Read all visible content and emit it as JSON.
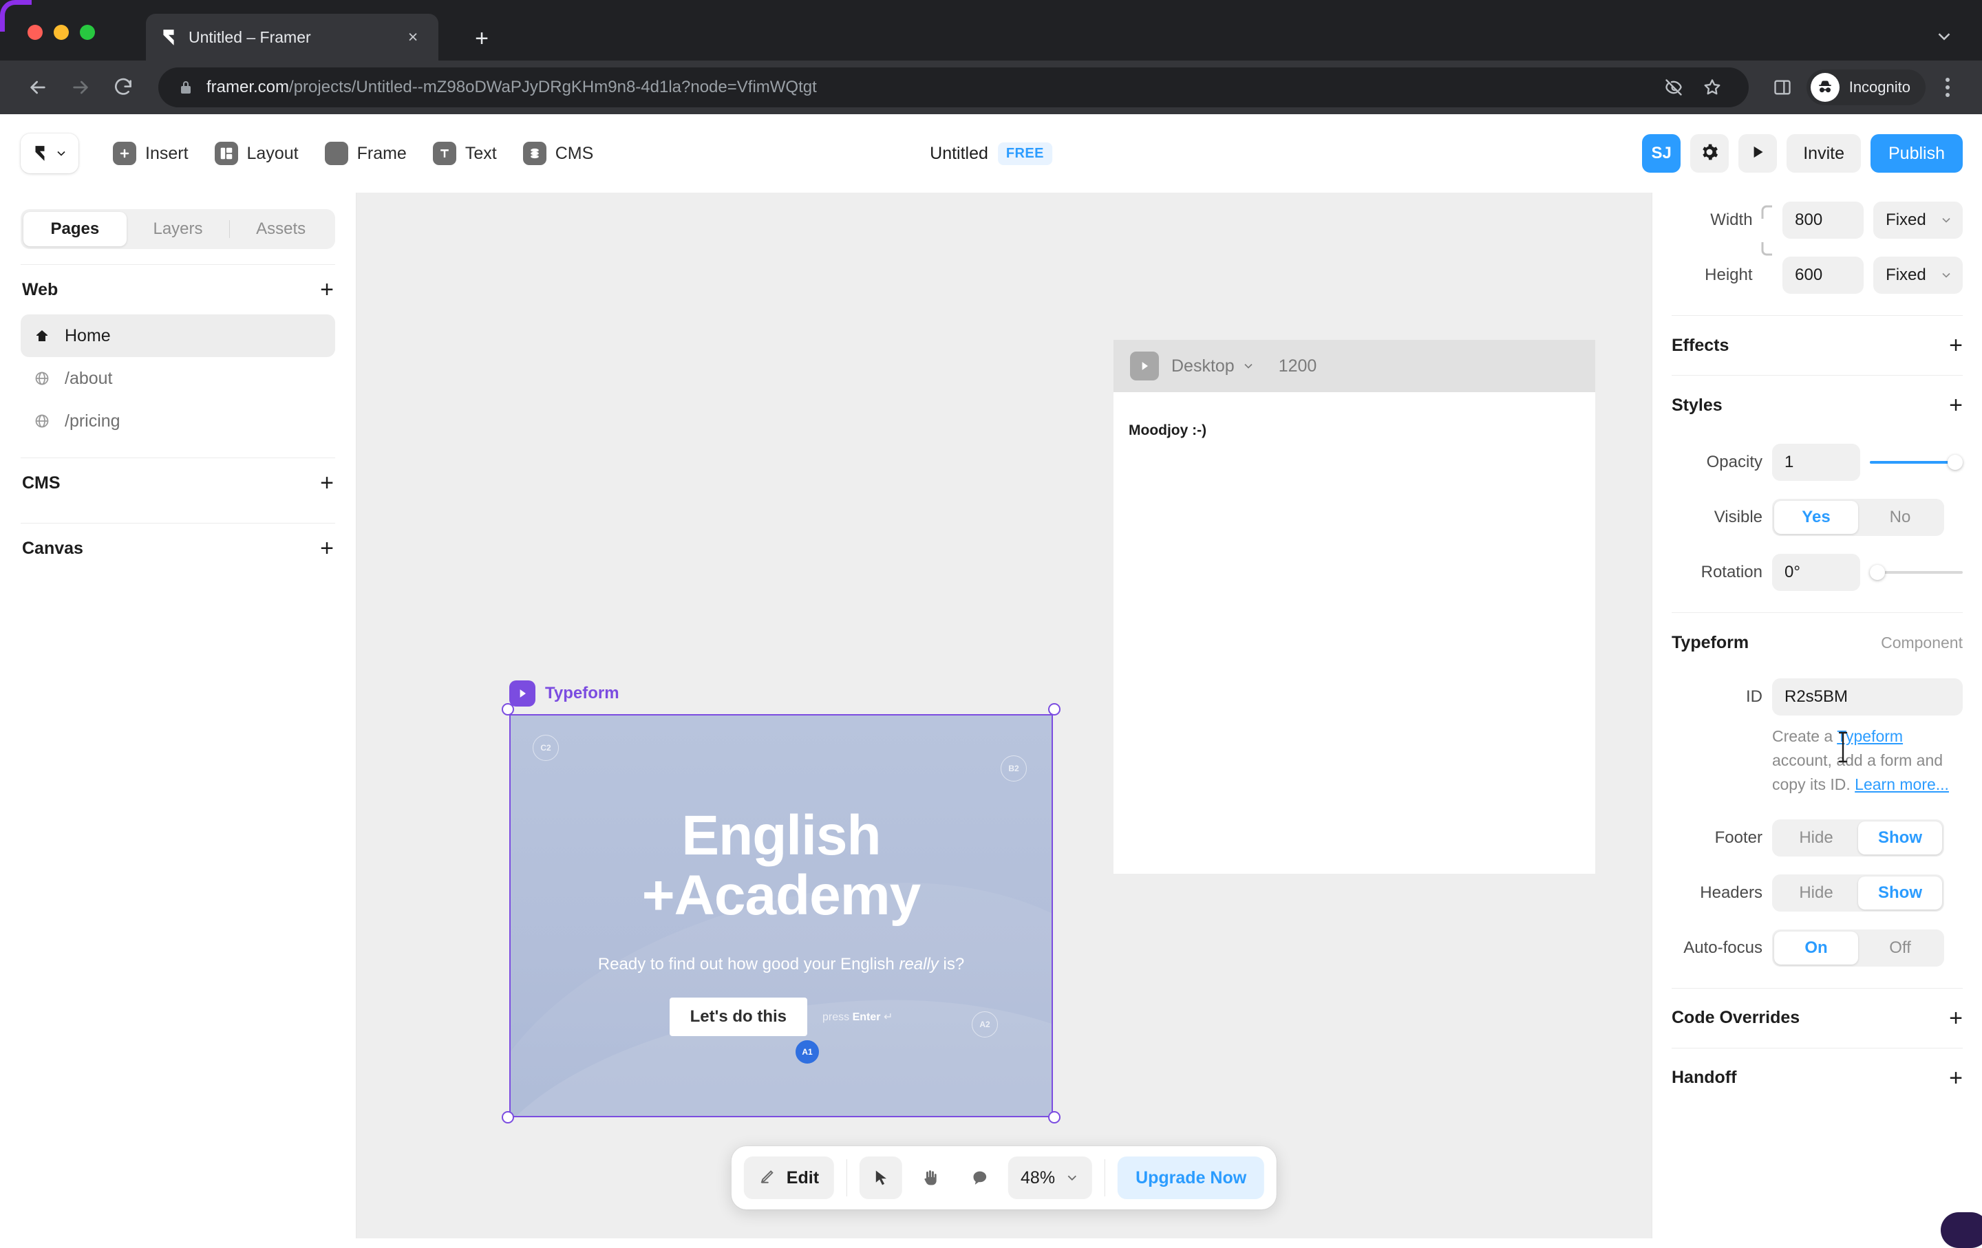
{
  "browser": {
    "tab": {
      "title": "Untitled – Framer",
      "favicon": "framer-favicon",
      "close": "×"
    },
    "new_tab": "+",
    "url": {
      "host": "framer.com",
      "path": "/projects/Untitled--mZ98oDWaPJyDRgKHm9n8-4d1la?node=VfimWQtgt"
    },
    "profile": {
      "label": "Incognito"
    },
    "icons": [
      "eye-off-icon",
      "star-icon",
      "side-panel-icon",
      "incognito-icon",
      "kebab-menu-icon"
    ]
  },
  "app": {
    "toolbar": {
      "logo": "framer-logo",
      "items": [
        {
          "label": "Insert",
          "icon": "plus-square-icon"
        },
        {
          "label": "Layout",
          "icon": "layout-icon"
        },
        {
          "label": "Frame",
          "icon": "frame-icon"
        },
        {
          "label": "Text",
          "icon": "text-t-icon"
        },
        {
          "label": "CMS",
          "icon": "cms-database-icon"
        }
      ],
      "doc_title": "Untitled",
      "plan_badge": "FREE",
      "avatar_initials": "SJ",
      "settings_icon": "gear-icon",
      "preview_icon": "play-icon",
      "invite_label": "Invite",
      "publish_label": "Publish"
    },
    "sidebar": {
      "tabs": [
        {
          "label": "Pages",
          "active": true
        },
        {
          "label": "Layers",
          "active": false
        },
        {
          "label": "Assets",
          "active": false
        }
      ],
      "sections": [
        {
          "title": "Web",
          "add": "+",
          "items": [
            {
              "label": "Home",
              "icon": "home-icon",
              "active": true
            },
            {
              "label": "/about",
              "icon": "globe-icon",
              "active": false
            },
            {
              "label": "/pricing",
              "icon": "globe-icon",
              "active": false
            }
          ]
        },
        {
          "title": "CMS",
          "add": "+",
          "items": []
        },
        {
          "title": "Canvas",
          "add": "+",
          "items": []
        }
      ]
    },
    "canvas": {
      "frame_right": {
        "device": "Desktop",
        "width": "1200",
        "content_text": "Moodjoy :-)",
        "play_icon": "play-icon",
        "chevron": "chevron-down-icon"
      },
      "selection": {
        "name": "Typeform",
        "badge_icon": "typeform-play-icon",
        "accent": "#7b4ce0",
        "preview": {
          "title_line1": "English",
          "title_line2": "+Academy",
          "subtitle_pre": "Ready to find out how good your English ",
          "subtitle_em": "really",
          "subtitle_post": " is?",
          "cta": "Let's do this",
          "hint_pre": "press ",
          "hint_key": "Enter",
          "hint_symbol": "↵",
          "chips": [
            "C2",
            "B2",
            "A2",
            "A1"
          ]
        }
      },
      "bottom_bar": {
        "edit_label": "Edit",
        "edit_icon": "pencil-icon",
        "tools": [
          {
            "icon": "cursor-arrow-icon",
            "active": true
          },
          {
            "icon": "hand-icon",
            "active": false
          },
          {
            "icon": "comment-icon",
            "active": false
          }
        ],
        "zoom": "48%",
        "zoom_chevron": "chevron-down-icon",
        "upgrade_label": "Upgrade Now"
      }
    },
    "right_panel": {
      "size": {
        "width_label": "Width",
        "width_value": "800",
        "width_mode": "Fixed",
        "height_label": "Height",
        "height_value": "600",
        "height_mode": "Fixed",
        "lock_icon": "link-constraint-icon",
        "chevron": "chevron-down-icon"
      },
      "effects": {
        "title": "Effects",
        "add": "+"
      },
      "styles": {
        "title": "Styles",
        "add": "+",
        "opacity_label": "Opacity",
        "opacity_value": "1",
        "opacity_pct": 100,
        "visible_label": "Visible",
        "visible_yes": "Yes",
        "visible_no": "No",
        "visible_state": "Yes",
        "rotation_label": "Rotation",
        "rotation_value": "0°",
        "rotation_pct": 0
      },
      "component": {
        "title": "Typeform",
        "kind": "Component",
        "id_label": "ID",
        "id_value": "R2s5BM",
        "help_pre": "Create a ",
        "help_link1": "Typeform",
        "help_mid": " account, add a form and copy its ID. ",
        "help_link2": "Learn more...",
        "footer_label": "Footer",
        "footer_hide": "Hide",
        "footer_show": "Show",
        "footer_state": "Show",
        "headers_label": "Headers",
        "headers_hide": "Hide",
        "headers_show": "Show",
        "headers_state": "Show",
        "autofocus_label": "Auto-focus",
        "autofocus_on": "On",
        "autofocus_off": "Off",
        "autofocus_state": "On"
      },
      "code_overrides": {
        "title": "Code Overrides",
        "add": "+"
      },
      "handoff": {
        "title": "Handoff",
        "add": "+"
      }
    }
  },
  "colors": {
    "accent_blue": "#2b9cff",
    "typeform_purple": "#7b4ce0",
    "canvas_bg": "#eeeeee",
    "browser_dark": "#202124"
  }
}
